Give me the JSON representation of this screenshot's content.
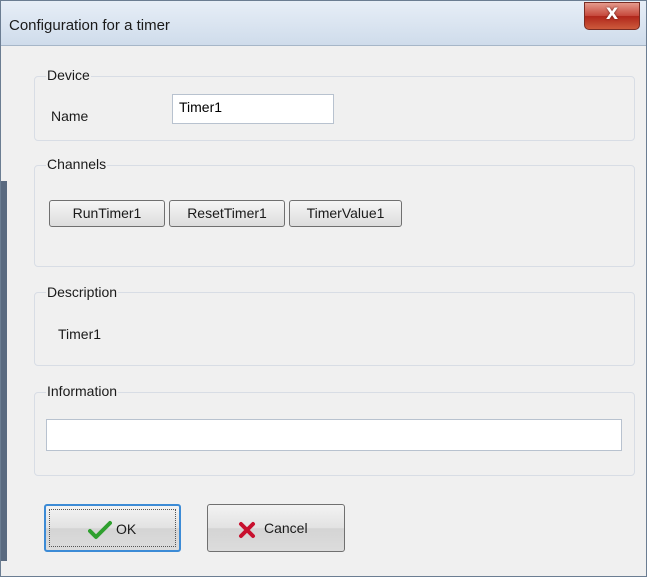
{
  "window": {
    "title": "Configuration for a timer",
    "close_glyph": "X"
  },
  "device": {
    "legend": "Device",
    "name_label": "Name",
    "name_value": "Timer1"
  },
  "channels": {
    "legend": "Channels",
    "buttons": [
      "RunTimer1",
      "ResetTimer1",
      "TimerValue1"
    ]
  },
  "description": {
    "legend": "Description",
    "text": "Timer1"
  },
  "information": {
    "legend": "Information",
    "value": ""
  },
  "actions": {
    "ok_label": "OK",
    "cancel_label": "Cancel"
  },
  "icons": {
    "ok": "green-checkmark-icon",
    "cancel": "red-x-icon"
  },
  "colors": {
    "ok_icon": "#2fa02f",
    "cancel_icon": "#c8102e",
    "close_button": "#c5473a"
  }
}
